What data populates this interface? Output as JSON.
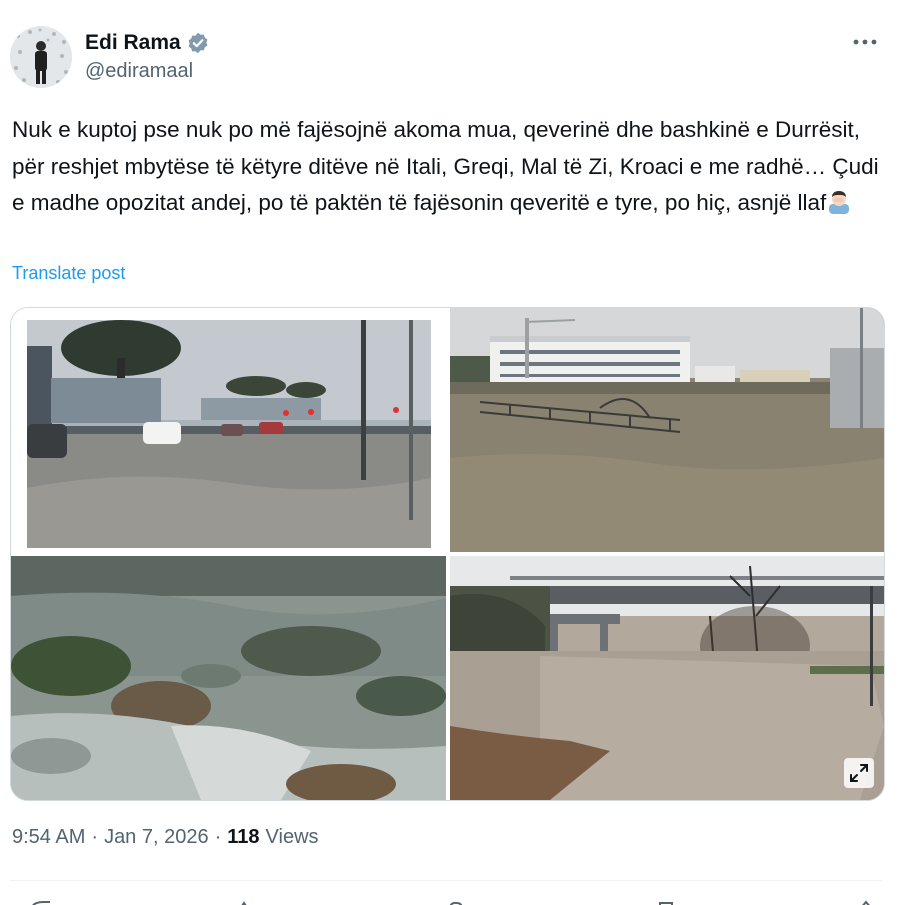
{
  "author": {
    "display_name": "Edi Rama",
    "handle": "@ediramaal",
    "verified": true,
    "avatar_icon": "avatar-photo"
  },
  "post": {
    "text": "Nuk e kuptoj pse nuk po më fajësojnë akoma mua, qeverinë dhe bashkinë e Durrësit, për reshjet mbytëse të këtyre ditëve në Itali, Greqi, Mal të Zi, Kroaci e me radhë… Çudi e madhe opozitat andej, po të paktën të fajësonin qeveritë e tyre, po hiç, asnjë llaf",
    "emoji": "man-facepalming-emoji",
    "translate_label": "Translate post"
  },
  "media": {
    "photos": [
      {
        "name": "flooded-street-photo"
      },
      {
        "name": "flooded-building-lot-photo"
      },
      {
        "name": "flooded-field-photo"
      },
      {
        "name": "flooded-underpass-photo"
      }
    ],
    "expand_icon": "expand-icon"
  },
  "meta": {
    "time": "9:54 AM",
    "separator": "·",
    "date": "Jan 7, 2026",
    "views_count": "118",
    "views_label": "Views"
  },
  "colors": {
    "text_primary": "#0f1419",
    "text_secondary": "#536471",
    "link": "#1d9bf0",
    "verified_badge": "#829aab",
    "border": "#cfd9de"
  }
}
